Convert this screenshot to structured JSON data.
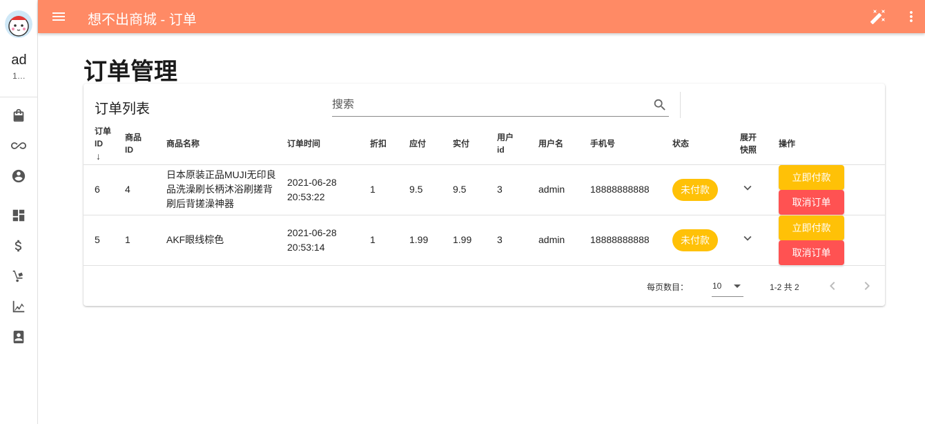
{
  "sidebar": {
    "user_name": "ad",
    "user_sub": "1…",
    "items": [
      {
        "icon": "shopping-bag-icon"
      },
      {
        "icon": "infinity-icon"
      },
      {
        "icon": "account-circle-icon"
      },
      {
        "icon": "dashboard-icon"
      },
      {
        "icon": "dollar-icon"
      },
      {
        "icon": "hand-truck-icon"
      },
      {
        "icon": "chart-icon"
      },
      {
        "icon": "contact-book-icon"
      }
    ]
  },
  "topbar": {
    "title": "想不出商城 - 订单",
    "color": "#ff8a65",
    "actions": [
      "theme-toggle-icon",
      "more-vert-icon"
    ]
  },
  "page": {
    "title": "订单管理"
  },
  "card": {
    "title": "订单列表",
    "search_placeholder": "搜索",
    "columns": [
      "订单ID",
      "商品ID",
      "商品名称",
      "订单时间",
      "折扣",
      "应付",
      "实付",
      "用户id",
      "用户名",
      "手机号",
      "状态",
      "展开快照",
      "操作"
    ],
    "columns_display": {
      "order_id": [
        "订单",
        "ID"
      ],
      "product_id": [
        "商品",
        "ID"
      ],
      "product_name": "商品名称",
      "order_time": "订单时间",
      "discount": "折扣",
      "payable": "应付",
      "paid": "实付",
      "user_id": [
        "用户",
        "id"
      ],
      "username": "用户名",
      "phone": "手机号",
      "status": "状态",
      "snapshot": [
        "展开",
        "快照"
      ],
      "ops": "操作"
    },
    "sort_indicator": "↓",
    "rows": [
      {
        "order_id": "6",
        "product_id": "4",
        "product_name": "日本原装正品MUJI无印良品洗澡刷长柄沐浴刷搓背刷后背搓澡神器",
        "date": "2021-06-28",
        "time": "20:53:22",
        "discount": "1",
        "payable": "9.5",
        "paid": "9.5",
        "user_id": "3",
        "username": "admin",
        "phone": "18888888888",
        "status": "未付款",
        "pay_label": "立即付款",
        "cancel_label": "取消订单"
      },
      {
        "order_id": "5",
        "product_id": "1",
        "product_name": "AKF眼线棕色",
        "date": "2021-06-28",
        "time": "20:53:14",
        "discount": "1",
        "payable": "1.99",
        "paid": "1.99",
        "user_id": "3",
        "username": "admin",
        "phone": "18888888888",
        "status": "未付款",
        "pay_label": "立即付款",
        "cancel_label": "取消订单"
      }
    ],
    "footer": {
      "per_page_label": "每页数目：",
      "per_page_value": "10",
      "range_text": "1-2 共 2"
    }
  },
  "colors": {
    "status_chip": "#ffc107",
    "pay_button": "#ffc107",
    "cancel_button": "#ff5252"
  }
}
